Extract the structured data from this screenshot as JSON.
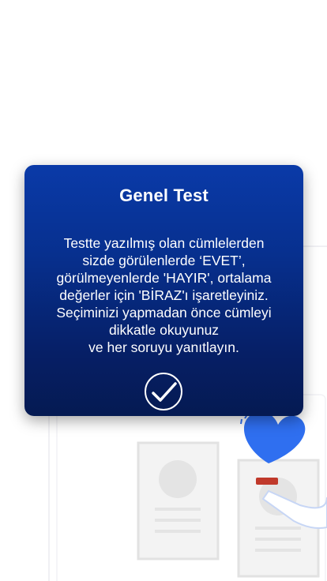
{
  "modal": {
    "title": "Genel Test",
    "instructions": [
      "Testte yazılmış olan cümlelerden",
      "sizde görülenlerde ‘EVET’,",
      "görülmeyenlerde 'HAYIR', ortalama",
      "değerler için 'BİRAZ'ı işaretleyiniz.",
      "Seçiminizi yapmadan önce cümleyi",
      "dikkatle okuyunuz",
      "ve her soruyu yanıtlayın."
    ],
    "confirm_icon": "checkmark-icon"
  },
  "colors": {
    "modal_top": "#0a3aa8",
    "modal_bottom": "#051a52",
    "heart": "#2f6ff0",
    "text": "#ffffff"
  }
}
